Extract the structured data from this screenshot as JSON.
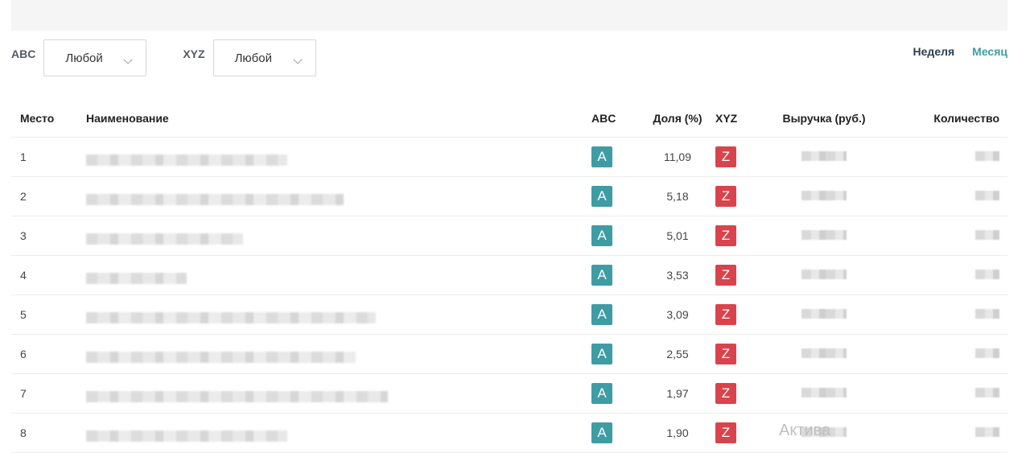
{
  "filters": {
    "abc_label": "ABC",
    "abc_value": "Любой",
    "xyz_label": "XYZ",
    "xyz_value": "Любой"
  },
  "period": {
    "week": "Неделя",
    "month": "Месяц"
  },
  "table": {
    "headers": {
      "place": "Место",
      "name": "Наименование",
      "abc": "ABC",
      "share": "Доля (%)",
      "xyz": "XYZ",
      "revenue": "Выручка (руб.)",
      "quantity": "Количество"
    },
    "rows": [
      {
        "place": "1",
        "abc": "A",
        "share": "11,09",
        "xyz": "Z"
      },
      {
        "place": "2",
        "abc": "A",
        "share": "5,18",
        "xyz": "Z"
      },
      {
        "place": "3",
        "abc": "A",
        "share": "5,01",
        "xyz": "Z"
      },
      {
        "place": "4",
        "abc": "A",
        "share": "3,53",
        "xyz": "Z"
      },
      {
        "place": "5",
        "abc": "A",
        "share": "3,09",
        "xyz": "Z"
      },
      {
        "place": "6",
        "abc": "A",
        "share": "2,55",
        "xyz": "Z"
      },
      {
        "place": "7",
        "abc": "A",
        "share": "1,97",
        "xyz": "Z"
      },
      {
        "place": "8",
        "abc": "A",
        "share": "1,90",
        "xyz": "Z"
      }
    ]
  },
  "watermark": "Актива",
  "colors": {
    "badge_a": "#3e9ca5",
    "badge_z": "#d9434c",
    "accent": "#3d9ea3"
  }
}
